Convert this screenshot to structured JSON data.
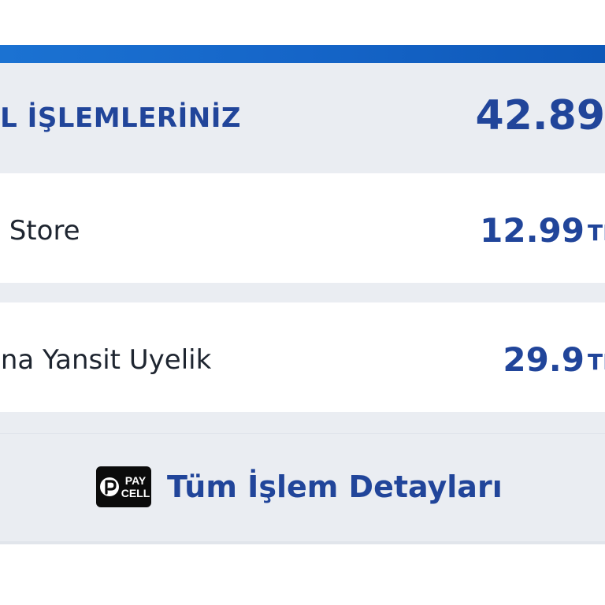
{
  "summary": {
    "title": "LL İŞLEMLERİNİZ",
    "total": "42.89"
  },
  "transactions": [
    {
      "name": "e Store",
      "amount": "12.99",
      "currency": "TL"
    },
    {
      "name": "ana Yansit Uyelik",
      "amount": "29.9",
      "currency": "TL"
    }
  ],
  "details": {
    "link_label": "Tüm İşlem Detayları",
    "logo_text_top": "PAY",
    "logo_text_bottom": "CELL"
  },
  "colors": {
    "accent": "#1565c8",
    "primary_text": "#21459a",
    "row_shade": "#eaedf2"
  }
}
